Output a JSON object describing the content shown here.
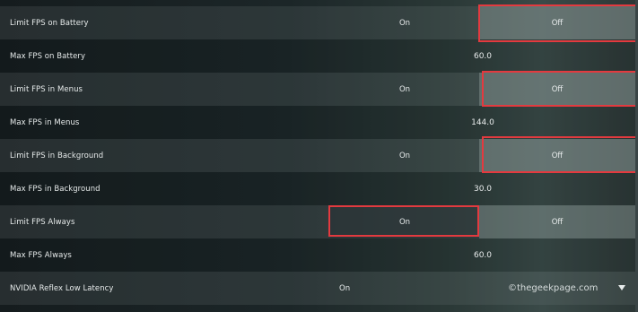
{
  "settings": [
    {
      "type": "toggle",
      "label": "Limit FPS on Battery",
      "on_label": "On",
      "off_label": "Off",
      "selected": "Off"
    },
    {
      "type": "value",
      "label": "Max FPS on Battery",
      "value": "60.0"
    },
    {
      "type": "toggle",
      "label": "Limit FPS in Menus",
      "on_label": "On",
      "off_label": "Off",
      "selected": "Off"
    },
    {
      "type": "value",
      "label": "Max FPS in Menus",
      "value": "144.0"
    },
    {
      "type": "toggle",
      "label": "Limit FPS in Background",
      "on_label": "On",
      "off_label": "Off",
      "selected": "Off"
    },
    {
      "type": "value",
      "label": "Max FPS in Background",
      "value": "30.0"
    },
    {
      "type": "toggle",
      "label": "Limit FPS Always",
      "on_label": "On",
      "off_label": "Off",
      "selected": "On"
    },
    {
      "type": "value",
      "label": "Max FPS Always",
      "value": "60.0"
    },
    {
      "type": "dropdown",
      "label": "NVIDIA Reflex Low Latency",
      "value": "On",
      "icon": "chevron-down-icon"
    }
  ],
  "watermark": "©thegeekpage.com",
  "colors": {
    "highlight": "#e33a3f",
    "text": "#e8ecec"
  }
}
